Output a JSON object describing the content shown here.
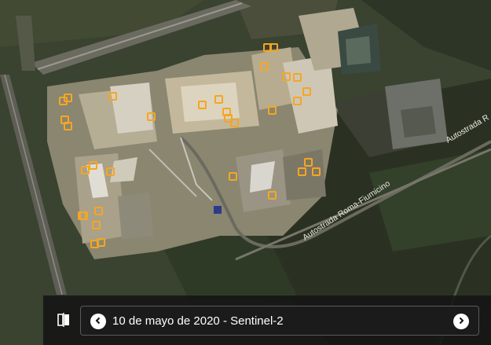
{
  "map": {
    "road_label": "Autostrada Roma-Fiumicino",
    "road_label_2": "Autostrada R"
  },
  "timeline": {
    "date_label": "10 de mayo de 2020 - Sentinel-2"
  },
  "icons": {
    "compare": "compare-icon",
    "prev": "chevron-left-icon",
    "next": "chevron-right-icon"
  },
  "colors": {
    "marker": "#f5a623",
    "bar_bg": "#141414",
    "label": "#ffffff"
  }
}
